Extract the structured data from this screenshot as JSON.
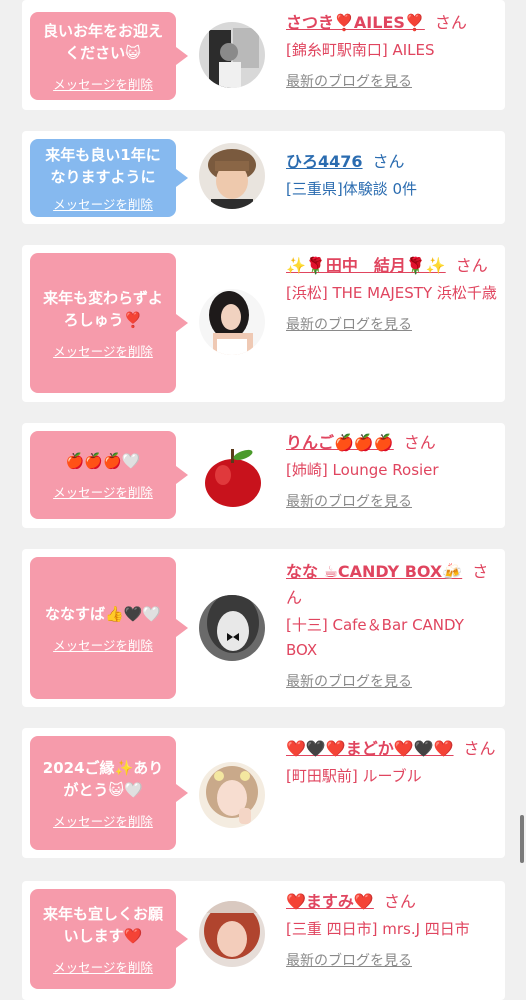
{
  "colors": {
    "background": "#f0f0f0",
    "card": "#ffffff",
    "bubble_pink": "#f69bab",
    "bubble_blue": "#86b9ef",
    "name_pink": "#e0455f",
    "name_blue": "#2b6cb0",
    "link_gray": "#8a8a8a"
  },
  "cards": [
    {
      "message": "良いお年をお迎えください😺",
      "delete_label": "メッセージを削除",
      "bubble_color": "pink",
      "name": "さつき❣️AILES❣️",
      "honorific": "さん",
      "shop": "[錦糸町駅南口] AILES",
      "blog_label": "最新のブログを見る",
      "avatar_icon": "photo-avatar"
    },
    {
      "message": "来年も良い1年になりますように",
      "delete_label": "メッセージを削除",
      "bubble_color": "blue",
      "name": "ひろ4476",
      "honorific": "さん",
      "shop": "[三重県]体験談 0件",
      "blog_label": "",
      "avatar_icon": "photo-avatar"
    },
    {
      "message": "来年も変わらずよろしゅう❣️",
      "delete_label": "メッセージを削除",
      "bubble_color": "pink",
      "name": "✨🌹田中　結月🌹✨",
      "honorific": "さん",
      "shop": "[浜松] THE MAJESTY 浜松千歳",
      "blog_label": "最新のブログを見る",
      "avatar_icon": "photo-avatar"
    },
    {
      "message": "🍎🍎🍎🤍",
      "delete_label": "メッセージを削除",
      "bubble_color": "pink",
      "name": "りんご🍎🍎🍎",
      "honorific": "さん",
      "shop": "[姉崎] Lounge Rosier",
      "blog_label": "最新のブログを見る",
      "avatar_icon": "apple-avatar"
    },
    {
      "message": "ななすば👍🖤🤍",
      "delete_label": "メッセージを削除",
      "bubble_color": "pink",
      "name": "なな ☕CANDY BOX🍻",
      "honorific": "さん",
      "shop": "[十三] Cafe＆Bar CANDY BOX",
      "blog_label": "最新のブログを見る",
      "avatar_icon": "photo-avatar"
    },
    {
      "message": "2024ご縁✨ありがとう😺🤍",
      "delete_label": "メッセージを削除",
      "bubble_color": "pink",
      "name": "❤️🖤❤️まどか❤️🖤❤️",
      "honorific": "さん",
      "shop": "[町田駅前] ルーブル",
      "blog_label": "",
      "avatar_icon": "photo-avatar"
    },
    {
      "message": "来年も宜しくお願いします❤️",
      "delete_label": "メッセージを削除",
      "bubble_color": "pink",
      "name": "❤️ますみ❤️",
      "honorific": "さん",
      "shop": "[三重 四日市] mrs.J 四日市",
      "blog_label": "最新のブログを見る",
      "avatar_icon": "photo-avatar"
    }
  ]
}
